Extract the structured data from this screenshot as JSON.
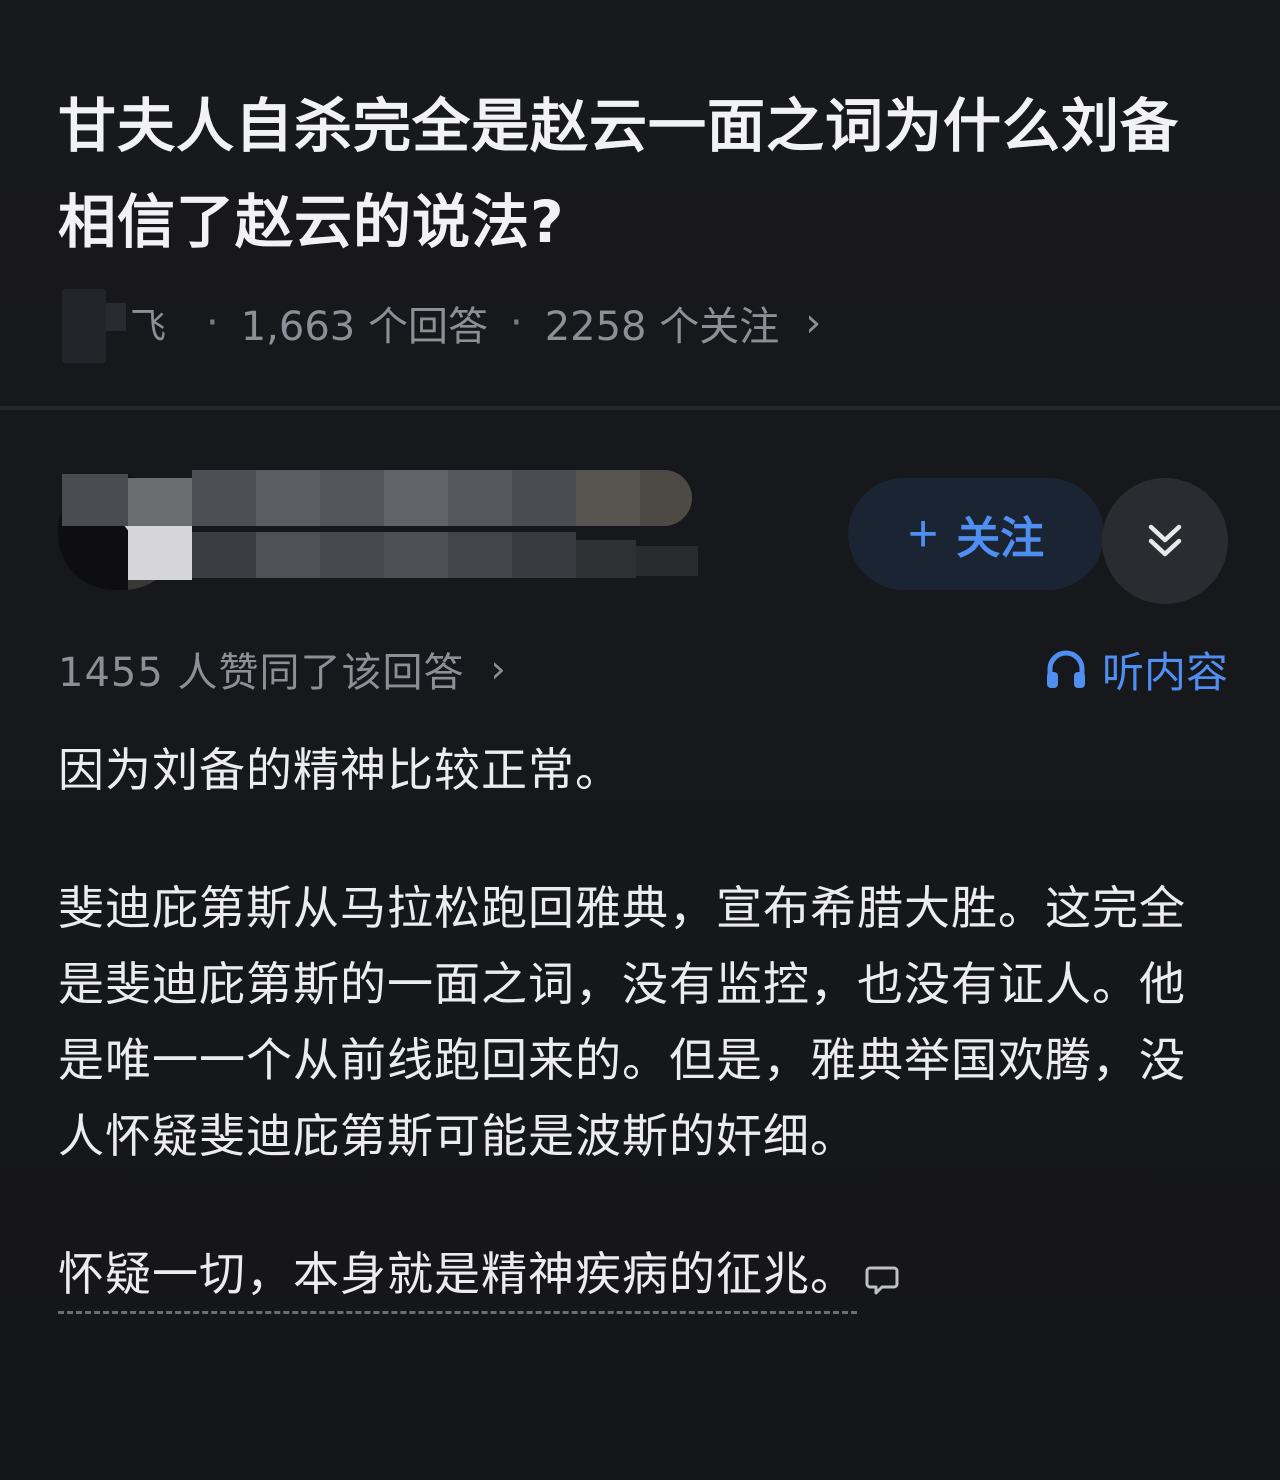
{
  "question": {
    "title": "甘夫人自杀完全是赵云一面之词为什么刘备相信了赵云的说法?",
    "topic_snippet": "飞",
    "answer_count": "1,663 个回答",
    "follow_count": "2258 个关注",
    "separator": "·",
    "chevron": "›"
  },
  "author": {
    "follow_label": "关注",
    "follow_plus": "+",
    "more_icon": "double-chevron-down-icon"
  },
  "answer_meta": {
    "votes_text": "1455 人赞同了该回答",
    "chevron": "›",
    "listen_label": "听内容"
  },
  "answer": {
    "paragraphs": [
      "因为刘备的精神比较正常。",
      "斐迪庇第斯从马拉松跑回雅典，宣布希腊大胜。这完全是斐迪庇第斯的一面之词，没有监控，也没有证人。他是唯一一个从前线跑回来的。但是，雅典举国欢腾，没人怀疑斐迪庇第斯可能是波斯的奸细。",
      "怀疑一切，本身就是精神疾病的征兆。"
    ]
  },
  "colors": {
    "background": "#16171b",
    "text": "#ececee",
    "muted": "#8d8f96",
    "accent": "#4f8ff2"
  }
}
